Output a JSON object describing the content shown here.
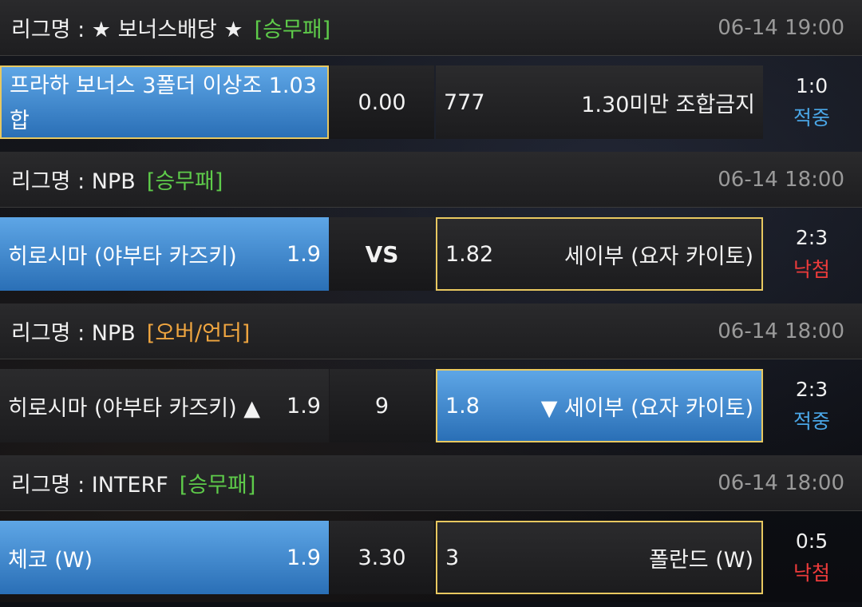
{
  "colors": {
    "green": "#5ecb4a",
    "orange": "#f0a640",
    "hit": "#4aa6e6",
    "miss": "#ee3b3b"
  },
  "leagues": [
    {
      "label": "리그명 : ★ 보너스배당 ★",
      "type": "[승무패]",
      "type_color": "green",
      "time": "06-14 19:00",
      "match": {
        "home_line1": "프라하 보너스 3폴더 이상조  1.03",
        "home_line2": "합",
        "mid": "0.00",
        "away_odds": "777",
        "away_name": "1.30미만 조합금지",
        "score": "1:0",
        "status": "적중"
      }
    },
    {
      "label": "리그명 : NPB",
      "type": "[승무패]",
      "type_color": "green",
      "time": "06-14 18:00",
      "match": {
        "home_name": "히로시마 (야부타 카즈키)",
        "home_odds": "1.9",
        "mid": "VS",
        "away_odds": "1.82",
        "away_name": "세이부 (요자 카이토)",
        "score": "2:3",
        "status": "낙첨"
      }
    },
    {
      "label": "리그명 : NPB",
      "type": "[오버/언더]",
      "type_color": "orange",
      "time": "06-14 18:00",
      "match": {
        "home_name": "히로시마 (야부타 카즈키) ▲",
        "home_odds": "1.9",
        "mid": "9",
        "away_odds": "1.8",
        "away_name": "▼ 세이부 (요자 카이토)",
        "score": "2:3",
        "status": "적중"
      }
    },
    {
      "label": "리그명 : INTERF",
      "type": "[승무패]",
      "type_color": "green",
      "time": "06-14 18:00",
      "match": {
        "home_name": "체코 (W)",
        "home_odds": "1.9",
        "mid": "3.30",
        "away_odds": "3",
        "away_name": "폴란드 (W)",
        "score": "0:5",
        "status": "낙첨"
      }
    }
  ]
}
